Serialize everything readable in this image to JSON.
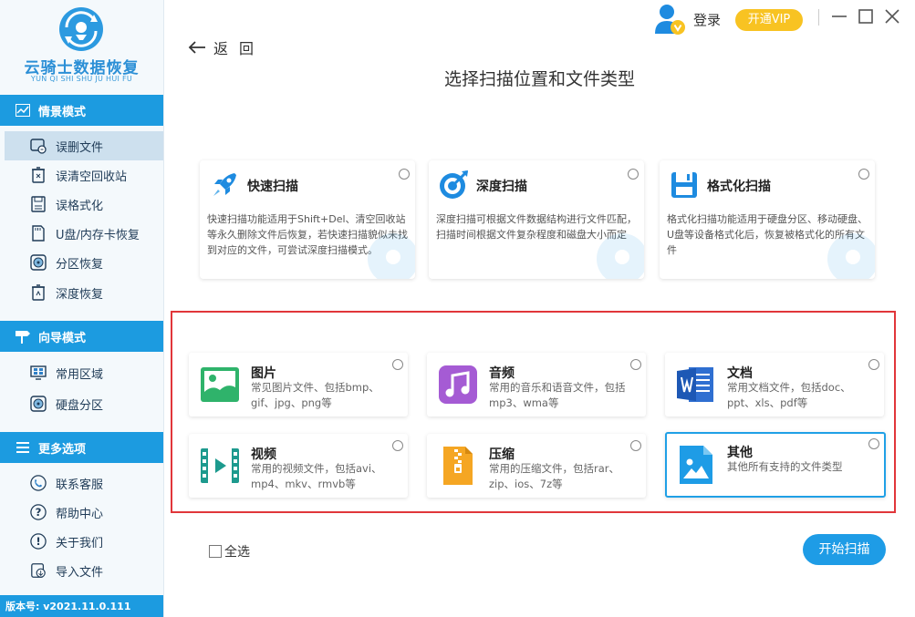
{
  "app": {
    "name": "云骑士数据恢复",
    "subtitle": "YUN QI SHI SHU JU HUI FU",
    "version": "版本号:  v2021.11.0.111"
  },
  "sidebar": {
    "sections": [
      {
        "label": "情景模式",
        "icon": "scene-icon"
      },
      {
        "label": "向导模式",
        "icon": "signpost-icon"
      },
      {
        "label": "更多选项",
        "icon": "menu-icon"
      }
    ],
    "scene_items": [
      {
        "label": "误删文件",
        "icon": "deleted-file-icon",
        "active": true
      },
      {
        "label": "误清空回收站",
        "icon": "recycle-bin-icon"
      },
      {
        "label": "误格式化",
        "icon": "format-icon"
      },
      {
        "label": "U盘/内存卡恢复",
        "icon": "sd-card-icon"
      },
      {
        "label": "分区恢复",
        "icon": "partition-icon"
      },
      {
        "label": "深度恢复",
        "icon": "deep-recovery-icon"
      }
    ],
    "guide_items": [
      {
        "label": "常用区域",
        "icon": "common-area-icon"
      },
      {
        "label": "硬盘分区",
        "icon": "disk-partition-icon"
      }
    ],
    "more_items": [
      {
        "label": "联系客服",
        "icon": "headset-icon"
      },
      {
        "label": "帮助中心",
        "icon": "help-icon"
      },
      {
        "label": "关于我们",
        "icon": "info-icon"
      },
      {
        "label": "导入文件",
        "icon": "import-icon"
      }
    ]
  },
  "header": {
    "back": "返回",
    "title": "选择扫描位置和文件类型",
    "login": "登录",
    "vip": "开通VIP"
  },
  "scan_modes": [
    {
      "title": "快速扫描",
      "desc": "快速扫描功能适用于Shift+Del、清空回收站等永久删除文件后恢复，若快速扫描貌似未找到对应的文件，可尝试深度扫描模式。",
      "icon": "rocket-icon"
    },
    {
      "title": "深度扫描",
      "desc": "深度扫描可根据文件数据结构进行文件匹配，扫描时间根据文件复杂程度和磁盘大小而定",
      "icon": "deep-scan-icon"
    },
    {
      "title": "格式化扫描",
      "desc": "格式化扫描功能适用于硬盘分区、移动硬盘、U盘等设备格式化后，恢复被格式化的所有文件",
      "icon": "format-scan-icon"
    }
  ],
  "file_types": [
    {
      "title": "图片",
      "desc": "常见图片文件、包括bmp、gif、jpg、png等",
      "icon": "image-icon"
    },
    {
      "title": "音频",
      "desc": "常用的音乐和语音文件，包括mp3、wma等",
      "icon": "music-icon"
    },
    {
      "title": "文档",
      "desc": "常用文档文件，包括doc、ppt、xls、pdf等",
      "icon": "document-icon"
    },
    {
      "title": "视频",
      "desc": "常用的视频文件，包括avi、mp4、mkv、rmvb等",
      "icon": "video-icon"
    },
    {
      "title": "压缩",
      "desc": "常用的压缩文件，包括rar、zip、ios、7z等",
      "icon": "zip-icon"
    },
    {
      "title": "其他",
      "desc": "其他所有支持的文件类型",
      "icon": "other-file-icon",
      "selected": true
    }
  ],
  "footer": {
    "select_all": "全选",
    "start": "开始扫描"
  },
  "colors": {
    "primary": "#1c9be0",
    "vip": "#f8c322",
    "highlight": "#e1363a"
  }
}
